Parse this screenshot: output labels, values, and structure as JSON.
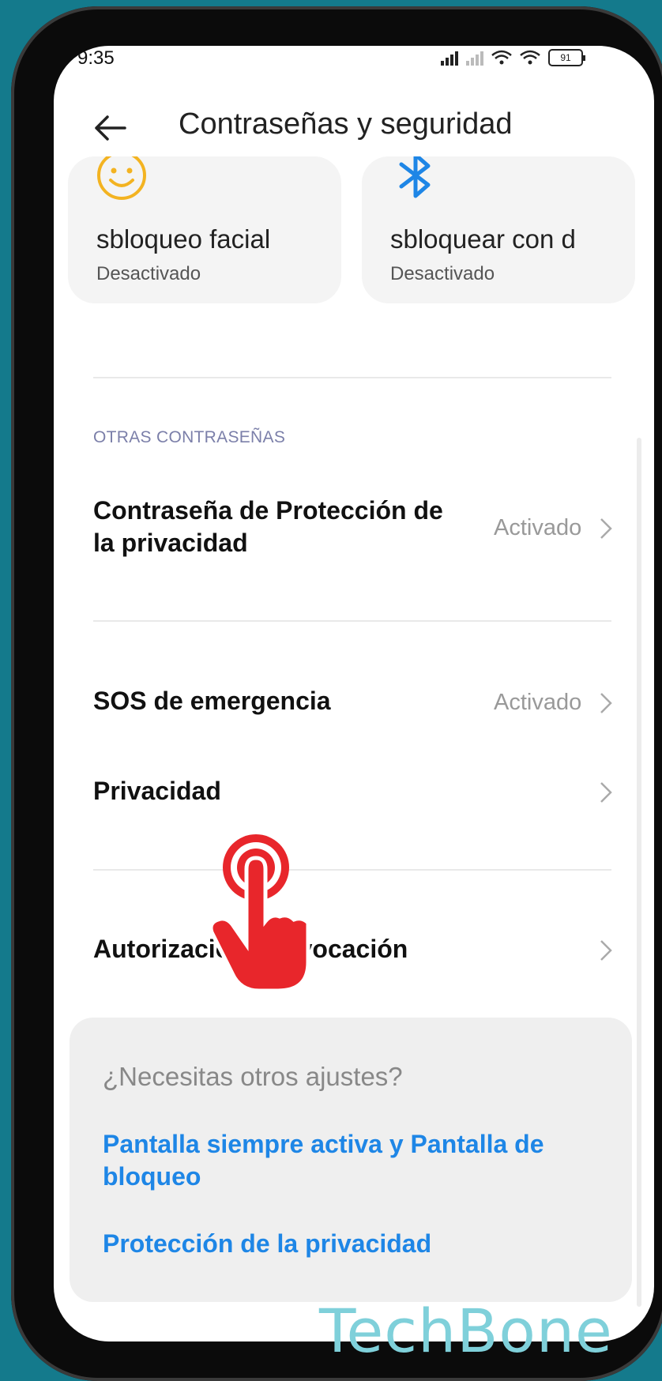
{
  "status_bar": {
    "time": "9:35",
    "battery": "91"
  },
  "header": {
    "title": "Contraseñas y seguridad"
  },
  "cards": [
    {
      "title": "sbloqueo facial",
      "subtitle": "Desactivado",
      "icon": "smiley-face-icon"
    },
    {
      "title": "sbloquear con d",
      "subtitle": "Desactivado",
      "icon": "bluetooth-icon"
    }
  ],
  "section": {
    "label": "OTRAS CONTRASEÑAS"
  },
  "rows": [
    {
      "title": "Contraseña de Protección de la privacidad",
      "status": "Activado"
    },
    {
      "title": "SOS de emergencia",
      "status": "Activado"
    },
    {
      "title": "Privacidad",
      "status": ""
    },
    {
      "title": "Autorización y revocación",
      "status": ""
    }
  ],
  "help": {
    "title": "¿Necesitas otros ajustes?",
    "links": [
      "Pantalla siempre activa y Pantalla de bloqueo",
      "Protección de la privacidad"
    ]
  },
  "watermark": "TechBone",
  "colors": {
    "accent": "#1e86e6",
    "background": "#147a8c",
    "tap_indicator": "#e8262b",
    "section_label": "#7b7fa9"
  }
}
